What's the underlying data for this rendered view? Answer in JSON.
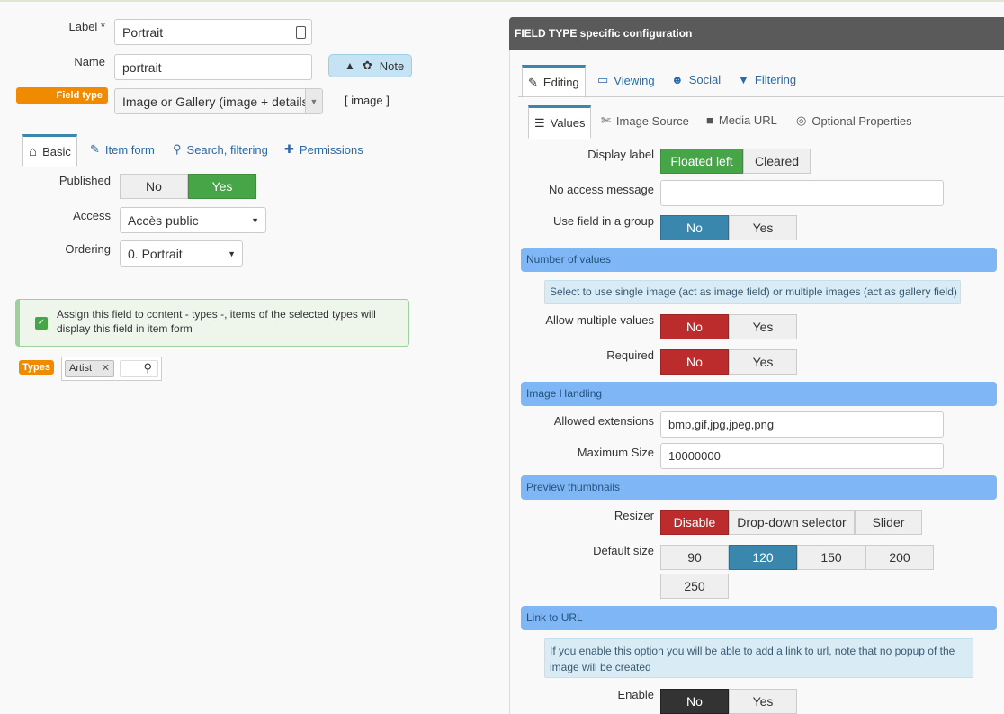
{
  "left": {
    "label_label": "Label *",
    "label_value": "Portrait",
    "name_label": "Name",
    "name_value": "portrait",
    "note_button": "Note",
    "field_type_label": "Field type",
    "field_type_value": "Image or Gallery (image + details)",
    "field_type_code": "[ image ]",
    "tabs": [
      {
        "label": "Basic"
      },
      {
        "label": "Item form"
      },
      {
        "label": "Search, filtering"
      },
      {
        "label": "Permissions"
      }
    ],
    "published_label": "Published",
    "published_no": "No",
    "published_yes": "Yes",
    "access_label": "Access",
    "access_value": "Accès public",
    "ordering_label": "Ordering",
    "ordering_value": "0. Portrait",
    "assign_text": "Assign this field to content - types -, items of the selected types will display this field in item form",
    "types_label": "Types",
    "types_tag": "Artist"
  },
  "right": {
    "header": "FIELD TYPE specific configuration",
    "tabs": [
      {
        "label": "Editing"
      },
      {
        "label": "Viewing"
      },
      {
        "label": "Social"
      },
      {
        "label": "Filtering"
      }
    ],
    "subtabs": [
      {
        "label": "Values"
      },
      {
        "label": "Image Source"
      },
      {
        "label": "Media URL"
      },
      {
        "label": "Optional Properties"
      }
    ],
    "display_label": "Display label",
    "display_floated": "Floated left",
    "display_cleared": "Cleared",
    "no_access_label": "No access message",
    "no_access_value": "",
    "use_group_label": "Use field in a group",
    "no": "No",
    "yes": "Yes",
    "section_number": "Number of values",
    "number_info": "Select to use single image (act as image field) or multiple images (act as gallery field)",
    "allow_multiple_label": "Allow multiple values",
    "required_label": "Required",
    "section_image": "Image Handling",
    "allowed_ext_label": "Allowed extensions",
    "allowed_ext_value": "bmp,gif,jpg,jpeg,png",
    "max_size_label": "Maximum Size",
    "max_size_value": "10000000",
    "section_preview": "Preview thumbnails",
    "resizer_label": "Resizer",
    "resizer_disable": "Disable",
    "resizer_dropdown": "Drop-down selector",
    "resizer_slider": "Slider",
    "default_size_label": "Default size",
    "sizes": [
      "90",
      "120",
      "150",
      "200",
      "250"
    ],
    "section_link": "Link to URL",
    "link_info": "If you enable this option you will be able to add a link to url, note that no popup of the image will be created",
    "enable_label": "Enable"
  },
  "colors": {
    "green": "#46a546",
    "blue": "#3a87ad",
    "red": "#bd2c2c",
    "orange": "#f08a00",
    "section": "#7fb6f6"
  }
}
